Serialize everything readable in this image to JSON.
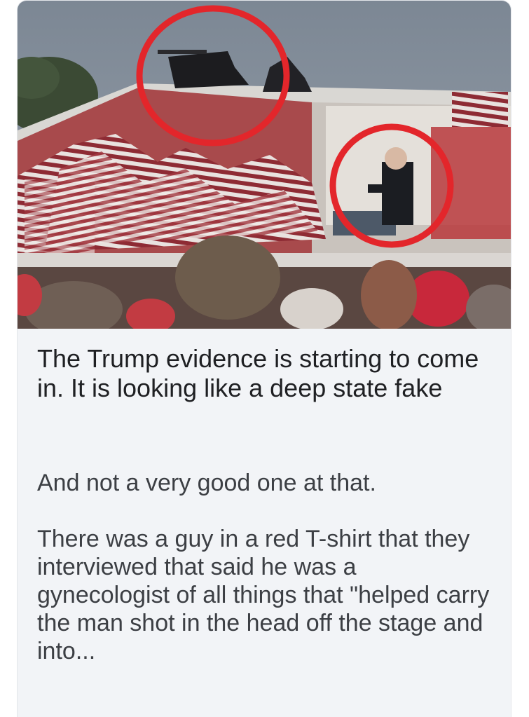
{
  "article": {
    "title": "The Trump evidence is starting to come in. It is looking like a deep state fake",
    "subtitle": "And not a very good one at that.",
    "excerpt": "There was a guy in a red T-shirt that they interviewed that said he was a gynecologist of all things that \"helped carry the man shot in the head off the stage and into..."
  },
  "image": {
    "subject": "rally-stage-photo",
    "annotation_color": "#e3262b"
  },
  "colors": {
    "card_background": "#f2f4f7",
    "title_text": "#1f2023",
    "body_text": "#3c3f44"
  }
}
